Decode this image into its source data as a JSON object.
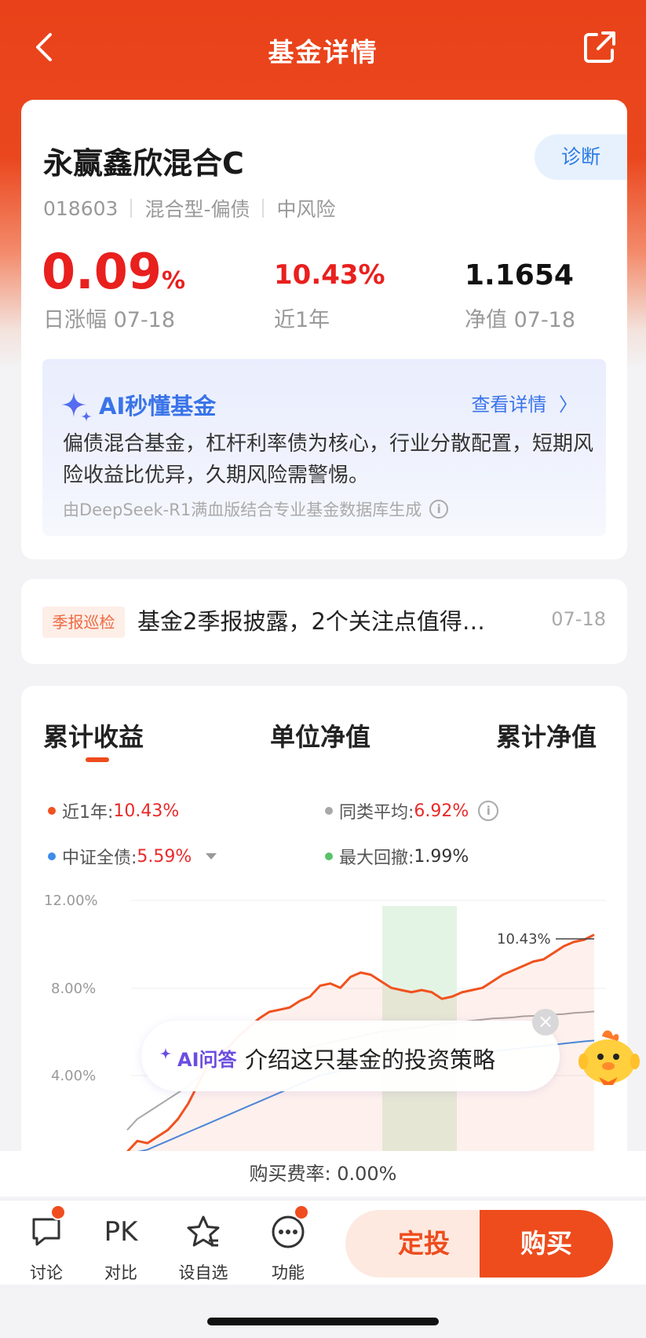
{
  "nav": {
    "title": "基金详情"
  },
  "fund": {
    "name": "永赢鑫欣混合C",
    "diagnose_label": "诊断",
    "code": "018603",
    "category": "混合型-偏债",
    "risk": "中风险",
    "daily_change": {
      "value": "0.09",
      "unit": "%",
      "label": "日涨幅 07-18"
    },
    "one_year": {
      "value": "10.43%",
      "label": "近1年"
    },
    "nav_value": {
      "value": "1.1654",
      "label": "净值 07-18"
    }
  },
  "ai_summary": {
    "title": "AI秒懂基金",
    "detail_link": "查看详情",
    "text": "偏债混合基金，杠杆利率债为核心，行业分散配置，短期风险收益比优异，久期风险需警惕。",
    "footer": "由DeepSeek-R1满血版结合专业基金数据库生成"
  },
  "news": {
    "tag": "季报巡检",
    "text": "基金2季报披露，2个关注点值得…",
    "date": "07-18"
  },
  "chart_tabs": [
    "累计收益",
    "单位净值",
    "累计净值"
  ],
  "legend": {
    "one_year_label": "近1年:",
    "one_year_value": "10.43%",
    "peer_label": "同类平均:",
    "peer_value": "6.92%",
    "index_label": "中证全债:",
    "index_value": "5.59%",
    "drawdown_label": "最大回撤:",
    "drawdown_value": "1.99%"
  },
  "chart_data": {
    "type": "line",
    "y_ticks": [
      "12.00%",
      "8.00%",
      "4.00%"
    ],
    "ylim": [
      0,
      12
    ],
    "end_label": "10.43%",
    "series": [
      {
        "name": "近1年",
        "color": "#f0521f",
        "values": [
          0.5,
          1.0,
          0.9,
          1.2,
          1.5,
          2.0,
          2.7,
          3.6,
          4.6,
          5.0,
          5.3,
          5.8,
          6.2,
          6.6,
          6.9,
          7.0,
          7.1,
          7.4,
          7.6,
          8.1,
          8.2,
          8.0,
          8.5,
          8.7,
          8.6,
          8.3,
          8.0,
          7.9,
          7.8,
          7.9,
          7.8,
          7.5,
          7.6,
          7.8,
          7.9,
          8.0,
          8.3,
          8.6,
          8.8,
          9.0,
          9.2,
          9.3,
          9.6,
          9.9,
          10.1,
          10.2,
          10.43
        ]
      },
      {
        "name": "同类平均",
        "color": "#a8a8a8",
        "values": [
          1.5,
          2.0,
          2.3,
          2.6,
          2.9,
          3.2,
          3.5,
          3.9,
          4.2,
          4.4,
          4.5,
          4.6,
          4.7,
          4.8,
          4.9,
          5.0,
          5.1,
          5.2,
          5.3,
          5.4,
          5.5,
          5.6,
          5.7,
          5.8,
          5.9,
          6.0,
          6.05,
          6.1,
          6.15,
          6.2,
          6.3,
          6.35,
          6.4,
          6.45,
          6.5,
          6.55,
          6.6,
          6.62,
          6.65,
          6.7,
          6.72,
          6.75,
          6.78,
          6.8,
          6.85,
          6.88,
          6.92
        ]
      },
      {
        "name": "中证全债",
        "color": "#3f8be8",
        "values": [
          0.3,
          0.5,
          0.6,
          0.8,
          1.0,
          1.2,
          1.4,
          1.6,
          1.8,
          2.0,
          2.2,
          2.4,
          2.6,
          2.8,
          3.0,
          3.2,
          3.4,
          3.6,
          3.8,
          4.0,
          4.1,
          4.2,
          4.3,
          4.35,
          4.4,
          4.45,
          4.5,
          4.55,
          4.6,
          4.7,
          4.75,
          4.8,
          4.9,
          4.95,
          5.0,
          5.05,
          5.1,
          5.15,
          5.2,
          5.25,
          5.3,
          5.35,
          5.4,
          5.45,
          5.5,
          5.55,
          5.59
        ]
      }
    ]
  },
  "ai_ask": {
    "label": "AI问答",
    "text": "介绍这只基金的投资策略"
  },
  "fee": "购买费率: 0.00%",
  "bottom_nav": {
    "discuss": "讨论",
    "compare_icon_text": "PK",
    "compare": "对比",
    "watchlist": "设自选",
    "more": "功能",
    "sip": "定投",
    "buy": "购买"
  }
}
